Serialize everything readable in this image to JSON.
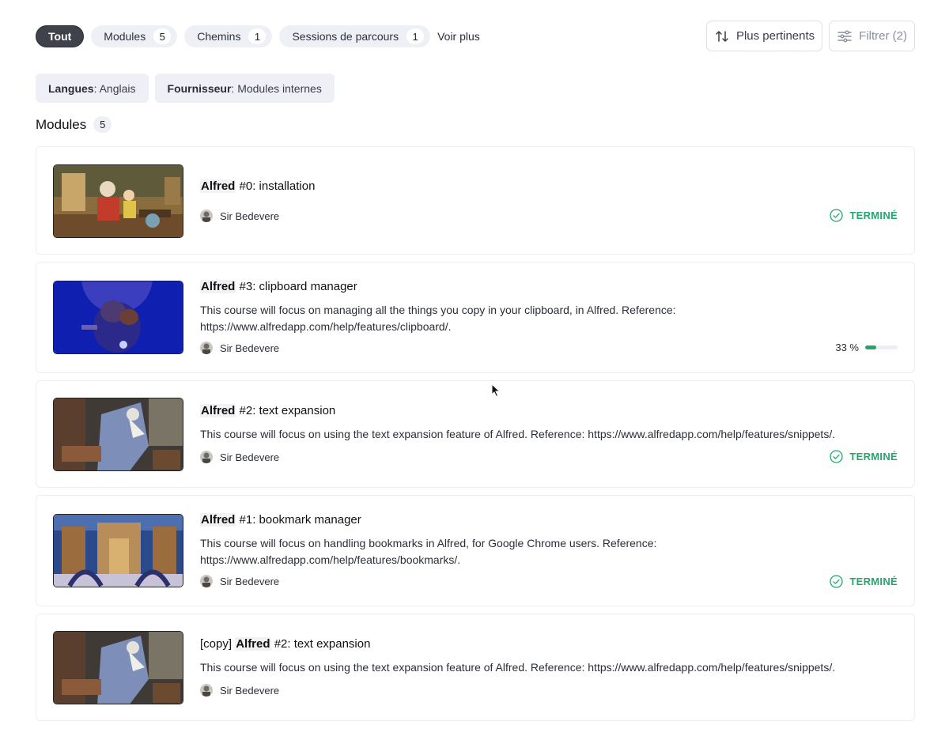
{
  "tabs": [
    {
      "label": "Tout"
    },
    {
      "label": "Modules",
      "count": "5"
    },
    {
      "label": "Chemins",
      "count": "1"
    },
    {
      "label": "Sessions de parcours",
      "count": "1"
    }
  ],
  "more_label": "Voir plus",
  "sort_button": {
    "label": "Plus pertinents",
    "icon": "sort-arrows-icon"
  },
  "filter_button": {
    "label": "Filtrer (2)",
    "icon": "sliders-icon"
  },
  "active_filters": [
    {
      "key": "Langues",
      "sep": ":",
      "value": " Anglais"
    },
    {
      "key": "Fournisseur",
      "sep": ":",
      "value": " Modules internes"
    }
  ],
  "section": {
    "title": "Modules",
    "count": "5"
  },
  "colors": {
    "accent_green": "#23a56b",
    "active_tab": "#3f424b",
    "chip_bg": "#eef0f5"
  },
  "modules": [
    {
      "prefix": "",
      "highlight": "Alfred",
      "rest": " #0: installation",
      "description": "",
      "author": "Sir Bedevere",
      "status": "TERMINÉ"
    },
    {
      "prefix": "",
      "highlight": "Alfred",
      "rest": " #3: clipboard manager",
      "description": "This course will focus on managing all the things you copy in your clipboard, in Alfred. Reference: https://www.alfredapp.com/help/features/clipboard/.",
      "author": "Sir Bedevere",
      "progress_label": "33 %",
      "progress": 0.33
    },
    {
      "prefix": "",
      "highlight": "Alfred",
      "rest": " #2: text expansion",
      "description": "This course will focus on using the text expansion feature of Alfred. Reference: https://www.alfredapp.com/help/features/snippets/.",
      "author": "Sir Bedevere",
      "status": "TERMINÉ"
    },
    {
      "prefix": "",
      "highlight": "Alfred",
      "rest": " #1: bookmark manager",
      "description": "This course will focus on handling bookmarks in Alfred, for Google Chrome users. Reference: https://www.alfredapp.com/help/features/bookmarks/.",
      "author": "Sir Bedevere",
      "status": "TERMINÉ"
    },
    {
      "prefix": "[copy] ",
      "highlight": "Alfred",
      "rest": " #2: text expansion",
      "description": "This course will focus on using the text expansion feature of Alfred. Reference: https://www.alfredapp.com/help/features/snippets/.",
      "author": "Sir Bedevere"
    }
  ]
}
